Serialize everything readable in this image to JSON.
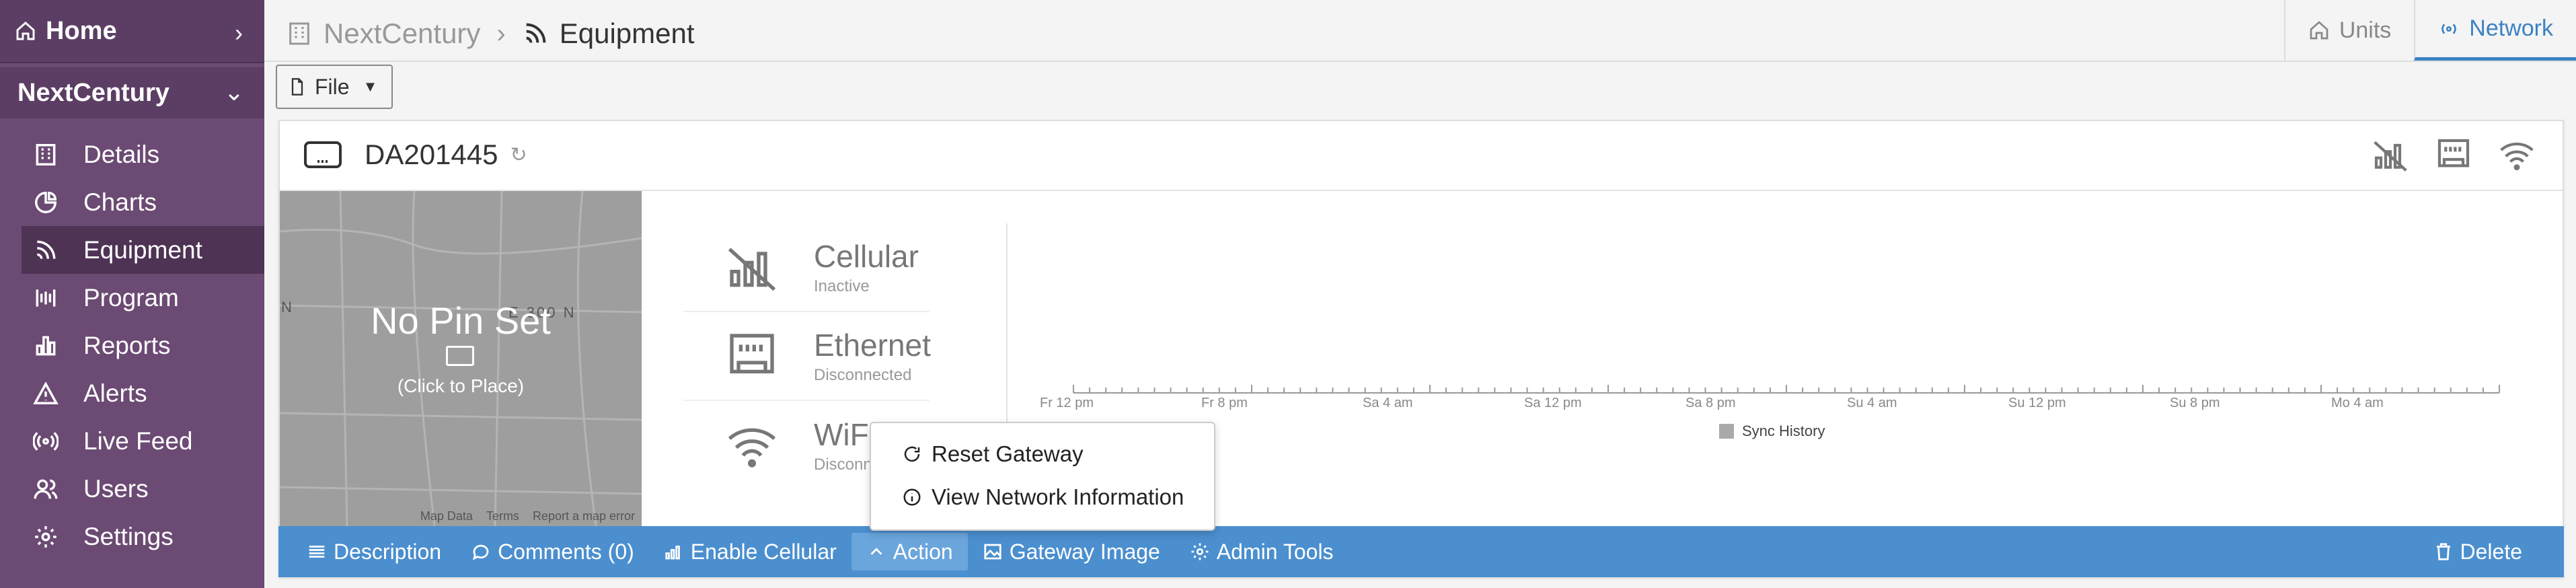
{
  "sidebar": {
    "home_label": "Home",
    "org_label": "NextCentury",
    "items": [
      {
        "label": "Details",
        "icon": "building-icon"
      },
      {
        "label": "Charts",
        "icon": "pie-chart-icon"
      },
      {
        "label": "Equipment",
        "icon": "rss-icon",
        "active": true
      },
      {
        "label": "Program",
        "icon": "program-icon"
      },
      {
        "label": "Reports",
        "icon": "bar-chart-icon"
      },
      {
        "label": "Alerts",
        "icon": "warning-icon"
      },
      {
        "label": "Live Feed",
        "icon": "broadcast-icon"
      },
      {
        "label": "Users",
        "icon": "users-icon"
      },
      {
        "label": "Settings",
        "icon": "gear-icon"
      }
    ]
  },
  "header": {
    "org": "NextCentury",
    "page": "Equipment",
    "tabs": [
      {
        "label": "Units"
      },
      {
        "label": "Network",
        "active": true
      }
    ]
  },
  "file_button": {
    "label": "File"
  },
  "device": {
    "id": "DA201445",
    "map": {
      "title": "No Pin Set",
      "subtitle": "(Click to Place)",
      "street_a": "N",
      "street_b": "E 300 N",
      "footer": [
        "Map Data",
        "Terms",
        "Report a map error"
      ]
    },
    "status": [
      {
        "name": "Cellular",
        "state": "Inactive"
      },
      {
        "name": "Ethernet",
        "state": "Disconnected"
      },
      {
        "name": "WiFi",
        "state": "Disconnected"
      }
    ],
    "timeline_labels": [
      "Fr 12 pm",
      "Fr 8 pm",
      "Sa 4 am",
      "Sa 12 pm",
      "Sa 8 pm",
      "Su 4 am",
      "Su 12 pm",
      "Su 8 pm",
      "Mo 4 am"
    ],
    "legend": "Sync History"
  },
  "dropdown": {
    "reset": "Reset Gateway",
    "view": "View Network Information"
  },
  "actions": {
    "description": "Description",
    "comments": "Comments (0)",
    "enable_cellular": "Enable Cellular",
    "action": "Action",
    "gateway_image": "Gateway Image",
    "admin_tools": "Admin Tools",
    "delete": "Delete"
  },
  "colors": {
    "sidebar": "#6b4a73",
    "actionbar": "#4b8fcf",
    "accent": "#3b82c4"
  }
}
